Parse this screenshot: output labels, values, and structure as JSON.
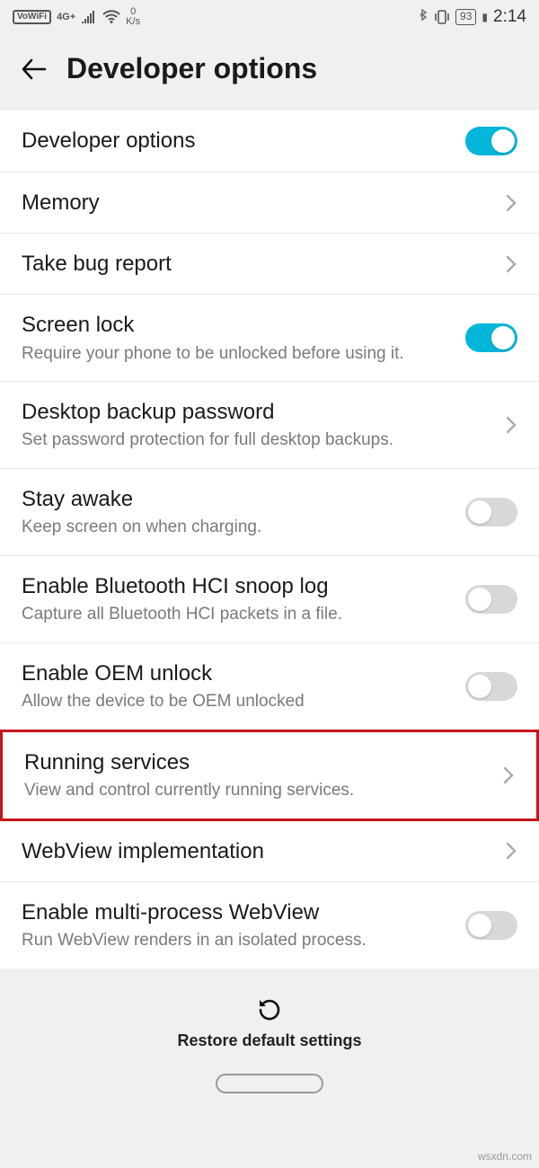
{
  "status": {
    "vowifi": "VoWiFi",
    "network": "4G+",
    "speed_top": "0",
    "speed_bottom": "K/s",
    "battery": "93",
    "time": "2:14"
  },
  "header": {
    "title": "Developer options"
  },
  "rows": {
    "dev_options": {
      "title": "Developer options"
    },
    "memory": {
      "title": "Memory"
    },
    "bug_report": {
      "title": "Take bug report"
    },
    "screen_lock": {
      "title": "Screen lock",
      "sub": "Require your phone to be unlocked before using it."
    },
    "desktop_backup": {
      "title": "Desktop backup password",
      "sub": "Set password protection for full desktop backups."
    },
    "stay_awake": {
      "title": "Stay awake",
      "sub": "Keep screen on when charging."
    },
    "bt_snoop": {
      "title": "Enable Bluetooth HCI snoop log",
      "sub": "Capture all Bluetooth HCI packets in a file."
    },
    "oem_unlock": {
      "title": "Enable OEM unlock",
      "sub": "Allow the device to be OEM unlocked"
    },
    "running_services": {
      "title": "Running services",
      "sub": "View and control currently running services."
    },
    "webview_impl": {
      "title": "WebView implementation"
    },
    "multi_webview": {
      "title": "Enable multi-process WebView",
      "sub": "Run WebView renders in an isolated process."
    }
  },
  "footer": {
    "restore": "Restore default settings"
  },
  "watermark": "wsxdn.com"
}
